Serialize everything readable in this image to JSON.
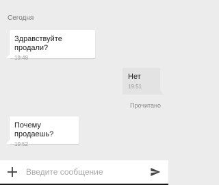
{
  "conversation": {
    "day_label": "Сегодня",
    "messages": [
      {
        "direction": "incoming",
        "text": "Здравствуйте продали?",
        "time": "19:48"
      },
      {
        "direction": "outgoing",
        "text": "Нет",
        "time": "19:51",
        "status": "Прочитано"
      },
      {
        "direction": "incoming",
        "text": "Почему продаешь?",
        "time": "19:52"
      }
    ]
  },
  "composer": {
    "placeholder": "Введите сообщение",
    "value": "",
    "attach_icon": "plus-icon",
    "send_icon": "send-icon"
  },
  "colors": {
    "background": "#ececec",
    "incoming_bubble": "#ffffff",
    "outgoing_bubble": "#e3e3e3",
    "icon": "#444444"
  }
}
